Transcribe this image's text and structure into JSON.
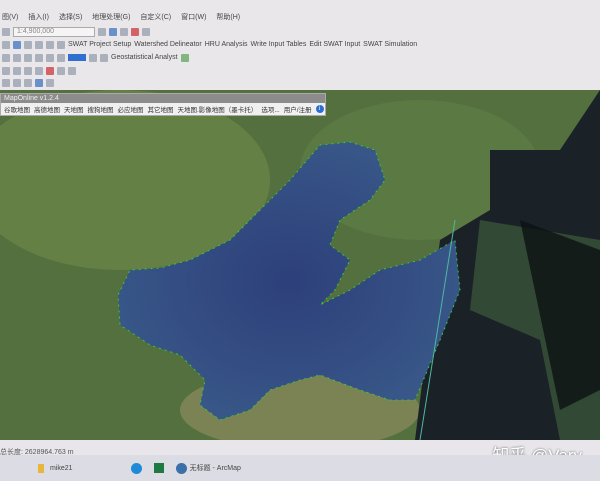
{
  "menu": [
    "图(V)",
    "插入(I)",
    "选择(S)",
    "地理处理(G)",
    "自定义(C)",
    "窗口(W)",
    "帮助(H)"
  ],
  "toolbar": {
    "scale": "1:4,900,000",
    "swat": [
      "SWAT Project Setup",
      "Watershed Delineator",
      "HRU Analysis",
      "Write Input Tables",
      "Edit SWAT Input",
      "SWAT Simulation"
    ],
    "geostat": "Geostatistical Analyst"
  },
  "maponline": {
    "title": "MapOnline v1.2.4",
    "items": [
      "谷歌地图",
      "高德地图",
      "天地图",
      "搜狗地图",
      "必应地图",
      "其它地图",
      "天地图.影像地图（墨卡托）",
      "选项...",
      "用户/注册"
    ]
  },
  "status": {
    "measure": "总长度: 2628964.763 m"
  },
  "taskbar": {
    "folder": "mike21",
    "arcmap": "无标题 - ArcMap"
  },
  "watermark": "知乎 @Vary"
}
